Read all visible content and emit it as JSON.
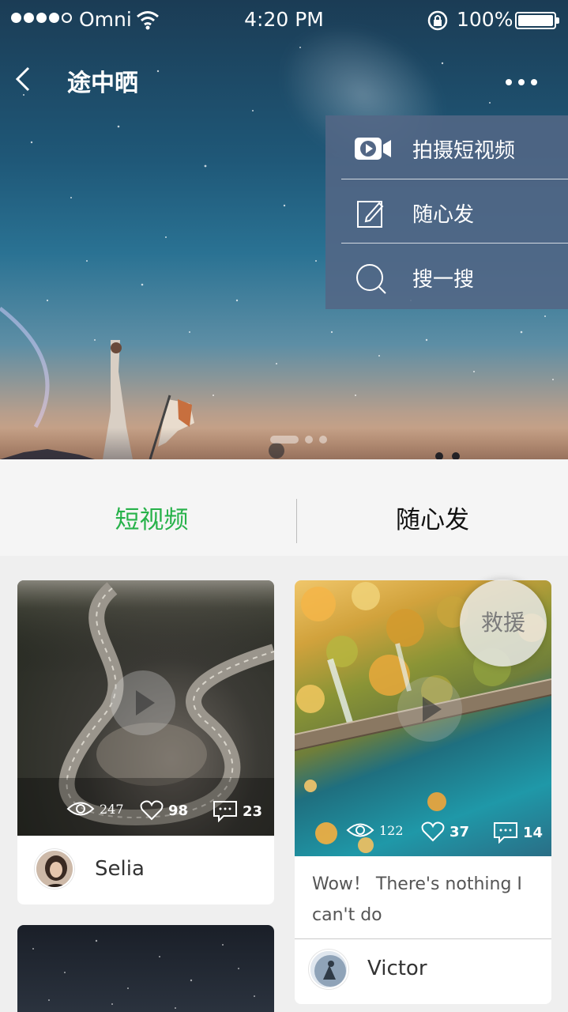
{
  "status_bar": {
    "carrier": "Omni",
    "time": "4:20 PM",
    "battery": "100%"
  },
  "nav": {
    "title": "途中晒"
  },
  "menu": {
    "items": [
      {
        "label": "拍摄短视频",
        "icon": "video-camera-icon"
      },
      {
        "label": "随心发",
        "icon": "edit-icon"
      },
      {
        "label": "搜一搜",
        "icon": "search-icon"
      }
    ]
  },
  "carousel": {
    "page_count": 3,
    "active_index": 0
  },
  "tabs": [
    {
      "label": "短视频",
      "active": true
    },
    {
      "label": "随心发",
      "active": false
    }
  ],
  "feed": [
    {
      "views": "247",
      "likes": "98",
      "comments": "23",
      "author": "Selia",
      "description": ""
    },
    {
      "views": "122",
      "likes": "37",
      "comments": "14",
      "author": "Victor",
      "description": "Wow！ There's nothing I can't do"
    }
  ],
  "floating_button": {
    "label": "救援"
  },
  "colors": {
    "accent_green": "#27b24a",
    "menu_bg": "#536785",
    "page_bg": "#efefef"
  }
}
